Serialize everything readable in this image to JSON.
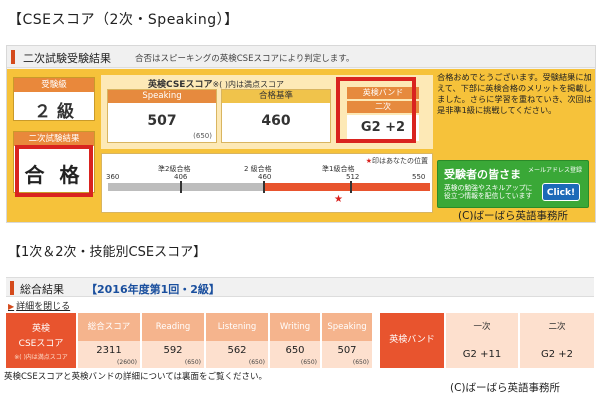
{
  "heading1": "【CSEスコア（2次・Speaking）】",
  "heading2": "【1次＆2次・技能別CSEスコア】",
  "panel1": {
    "title": "二次試験受験結果",
    "subtitle": "合否はスピーキングの英検CSEスコアにより判定します。",
    "grade_label": "受験級",
    "grade_value": "２ 級",
    "result_label": "二次試験結果",
    "result_value": "合 格",
    "cse_caption_bold": "英検CSEスコア",
    "cse_caption_note": "※( )内は満点スコア",
    "speaking_label": "Speaking",
    "speaking_value": "507",
    "speaking_max": "(650)",
    "pass_label": "合格基準",
    "pass_value": "460",
    "band_label": "英検バンド",
    "band_sub": "二次",
    "band_value": "G2 +2",
    "scale_note_mark": "★",
    "scale_note": "印はあなたの位置",
    "scale_labels": [
      "準2級合格",
      "2 級合格",
      "準1級合格"
    ],
    "scale_numbers": [
      "360",
      "406",
      "460",
      "512",
      "550"
    ],
    "star": "★",
    "message": "合格おめでとうございます。受験結果に加えて、下部に英検合格のメリットを掲載しました。さらに学習を重ねていき、次回は是非準1級に挑戦してください。",
    "promo_title": "受験者の皆さま",
    "promo_mail": "メールアドレス登録",
    "promo_desc": "英検の勉強やスキルアップに役立つ情報を配信しています",
    "promo_button": "Click!",
    "copyright": "(C)ばーばら英語事務所"
  },
  "panel2": {
    "title": "総合結果",
    "year": "【2016年度第1回・2級】",
    "detail_arrow": "▶",
    "detail_link": "詳細を閉じる",
    "cse_label_1": "英検",
    "cse_label_2": "CSEスコア",
    "cse_label_3": "※( )内は満点スコア",
    "columns": [
      {
        "label": "総合スコア",
        "value": "2311",
        "max": "(2600)"
      },
      {
        "label": "Reading",
        "value": "592",
        "max": "(650)"
      },
      {
        "label": "Listening",
        "value": "562",
        "max": "(650)"
      },
      {
        "label": "Writing",
        "value": "650",
        "max": "(650)"
      },
      {
        "label": "Speaking",
        "value": "507",
        "max": "(650)"
      }
    ],
    "band_label": "英検バンド",
    "band_columns": [
      {
        "label": "一次",
        "value": "G2 +11"
      },
      {
        "label": "二次",
        "value": "G2 +2"
      }
    ],
    "footnote": "英検CSEスコアと英検バンドの詳細については裏面をご覧ください。",
    "copyright": "(C)ばーばら英語事務所"
  },
  "colors": {
    "orange": "#e8542e",
    "yellow": "#f6c23a",
    "highlight_red": "#d9231f",
    "promo_green": "#3aa837"
  }
}
